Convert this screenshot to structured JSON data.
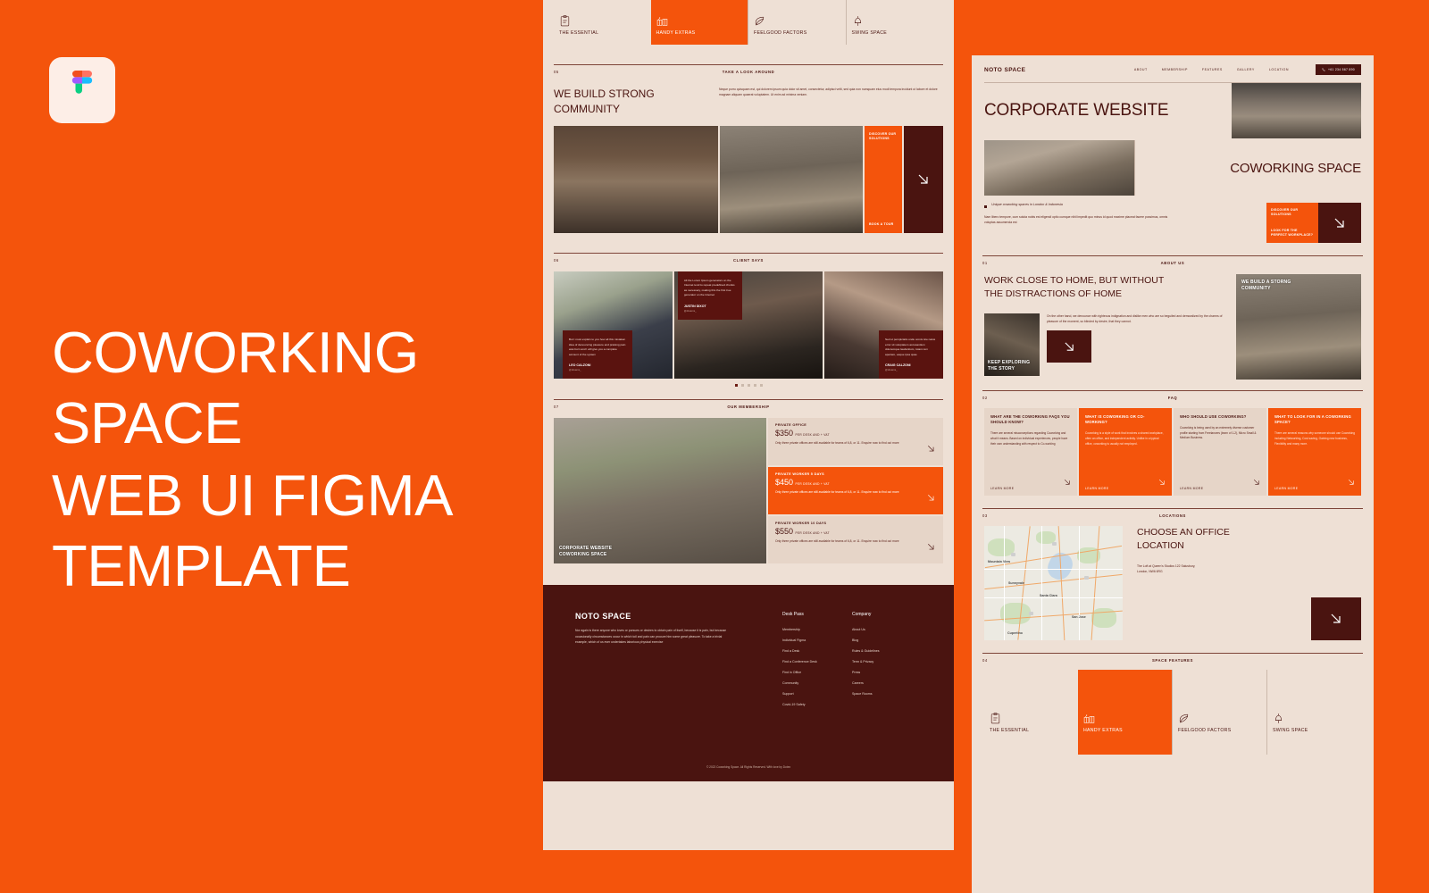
{
  "promo": {
    "brand_icon": "figma-logo",
    "title_lines": [
      "COWORKING",
      "SPACE",
      "WEB UI FIGMA",
      "TEMPLATE"
    ],
    "background_color": "#f4540c",
    "text_color": "#ffffff"
  },
  "palette": {
    "orange": "#f4540c",
    "beige": "#eee0d5",
    "beige_card": "#e6d5c8",
    "dark_maroon": "#4a1410",
    "rule": "#7d4438"
  },
  "site": {
    "logo": "NOTO SPACE",
    "nav": [
      "ABOUT",
      "MEMBERSHIP",
      "FEATURES",
      "GALLERY",
      "LOCATION"
    ],
    "phone": "+61 234 567 890",
    "phone_icon": "phone-icon"
  },
  "hero": {
    "title": "CORPORATE WEBSITE",
    "subtitle": "COWORKING SPACE",
    "bullet": "Unique coworking spaces in London & Indonesia",
    "body": "Nam libero tempore, cum soluta nobis est eligendi optio cumque nihil impedit quo minus id quod maxime placeat facere possimus, omnis voluptas assumenda est",
    "cta_primary": "DISCOVER OUR SOLUTIONS",
    "cta_secondary": "LOOK FOR THE PERFECT WORKPLACE?"
  },
  "sections": {
    "about": {
      "num": "01",
      "label": "ABOUT US"
    },
    "faq": {
      "num": "02",
      "label": "FAQ"
    },
    "locations": {
      "num": "03",
      "label": "LOCATIONS"
    },
    "space_features": {
      "num": "04",
      "label": "SPACE FEATURES"
    },
    "gallery": {
      "num": "05",
      "label": "TAKE A LOOK AROUND"
    },
    "clients": {
      "num": "06",
      "label": "CLIENT SAYS"
    },
    "membership": {
      "num": "07",
      "label": "OUR MEMBERSHIP"
    }
  },
  "about": {
    "heading_line1": "WORK CLOSE TO HOME, BUT WITHOUT",
    "heading_line2": "THE DISTRACTIONS OF HOME",
    "body": "On the other hand, we denounce with righteous indignation and dislike men who are so beguiled and demoralized by the charms of pleasure of the moment, so blinded by desire, that they cannot.",
    "image_caption_left": "KEEP EXPLORING THE STORY",
    "image_caption_right": "WE BUILD A STORNG COMMUNITY"
  },
  "faq_cards": [
    {
      "title": "WHAT ARE THE COWORKING FAQS YOU SHOULD KNOW?",
      "body": "There are several misconceptions regarding Coworking and what it means. Based on individual experiences, people have their own understanding with respect to Co-working",
      "link": "LEARN MORE",
      "highlight": false
    },
    {
      "title": "WHAT IS COWORKING OR CO-WORKING?",
      "body": "Coworking is a style of work that involves a shared workplace, often an office, and independent activity. Unlike in a typical office, coworking is usually not employed.",
      "link": "LEARN MORE",
      "highlight": true
    },
    {
      "title": "WHO SHOULD USE COWORKING?",
      "body": "Coworking is being used by an extremely diverse customer profile starting from Freelancers (learn of 1-2), Micro Small & Medium Business.",
      "link": "LEARN MORE",
      "highlight": false
    },
    {
      "title": "WHAT TO LOOK FOR IN A COWORKING SPACE?",
      "body": "There are several reasons why someone should use Coworking including Networking, Cost saving, Gaining new business, Flexibility and many more.",
      "link": "LEARN MORE",
      "highlight": true
    }
  ],
  "locations": {
    "heading_line1": "CHOOSE AN OFFICE",
    "heading_line2": "LOCATION",
    "address_line1": "The Loft at Queen's Studios 122 Salusbury,",
    "address_line2": "London, NW6 6RG",
    "map_labels": [
      "Mountain View",
      "Sunnyvale",
      "Santa Clara",
      "San Jose",
      "Cupertino"
    ]
  },
  "space_features": [
    {
      "label": "THE ESSENTIAL",
      "icon": "clipboard-icon",
      "active": false
    },
    {
      "label": "HANDY EXTRAS",
      "icon": "gifts-icon",
      "active": true
    },
    {
      "label": "FEELGOOD FACTORS",
      "icon": "leaf-icon",
      "active": false
    },
    {
      "label": "SWING SPACE",
      "icon": "lamp-icon",
      "active": false
    }
  ],
  "gallery": {
    "heading_line1": "WE BUILD STRONG",
    "heading_line2": "COMMUNITY",
    "body": "Neque porro quisquam est, qui dolorem ipsum quia dolor sit amet, consectetur, adipisci velit, sed quia non numquam eius modi tempora incidunt ut labore et dolore magnam aliquam quaerat voluptatem. Ut enim ad minima veniam.",
    "cta_primary": "DISCOVER OUR SOLUTIONS",
    "cta_secondary": "BOOK A TOUR"
  },
  "testimonials": [
    {
      "quote": "But I must explain to you how all this mistaken idea of denouncing pleasure and praising pain was born and I will give you a complete account of the system",
      "name": "LEO CALZONI",
      "handle": "@dreams_"
    },
    {
      "quote": "All the Lorem Ipsum generators on the Internet tend to repeat predefined chunks as necessary, making this the first true generator on the Internet",
      "name": "JUSTIN DIXOT",
      "handle": "@dreams_"
    },
    {
      "quote": "Sed ut perspiciatis unde omnis iste natus error sit voluptatem accusantium doloremque laudantium, totam rem aperiam, eaque ipsa quae",
      "name": "CRAIG CALZONI",
      "handle": "@dreams_"
    }
  ],
  "carousel": {
    "dots": 5,
    "active_index": 0
  },
  "membership": {
    "image_caption": "CORPORATE WEBSITE COWORKING SPACE",
    "plans": [
      {
        "name": "PRIVATE OFFICE",
        "price": "$350",
        "period": "PER DESK AND + VAT",
        "desc": "Only three private offices are still available for teams of 6,8, or 11. Enquire now to find out more",
        "highlight": false
      },
      {
        "name": "PRIVATE WORKER 5 DAYS",
        "price": "$450",
        "period": "PER DESK AND + VAT",
        "desc": "Only three private offices are still available for teams of 6,8, or 11. Enquire now to find out more",
        "highlight": true
      },
      {
        "name": "PRIVATE WORKER 10 DAYS",
        "price": "$550",
        "period": "PER DESK AND + VAT",
        "desc": "Only three private offices are still available for teams of 6,8, or 11. Enquire now to find out more",
        "highlight": false
      }
    ]
  },
  "footer": {
    "logo": "NOTO SPACE",
    "about": "Nor again is there anyone who loves or pursues or desires to obtain pain of itself, because it is pain, but because occasionally circumstances occur in which toil and pain can procure him some great pleasure. To take a trivial example, which of us ever undertakes laborious physical exercise",
    "col1_title": "Desk Pass",
    "col1_links": [
      "Membership",
      "Individual Figma",
      "Find a Desk",
      "Find a Conference Desk",
      "Find in Office",
      "Community",
      "Support",
      "Covid-19 Safety"
    ],
    "col2_title": "Company",
    "col2_links": [
      "About Us",
      "Blog",
      "Rules & Guidelines",
      "Term & Privacy",
      "Press",
      "Careers",
      "Space Rooms"
    ],
    "copyright": "© 2022 Coworking Space. All Rights Reserved. With love by Dotex"
  }
}
